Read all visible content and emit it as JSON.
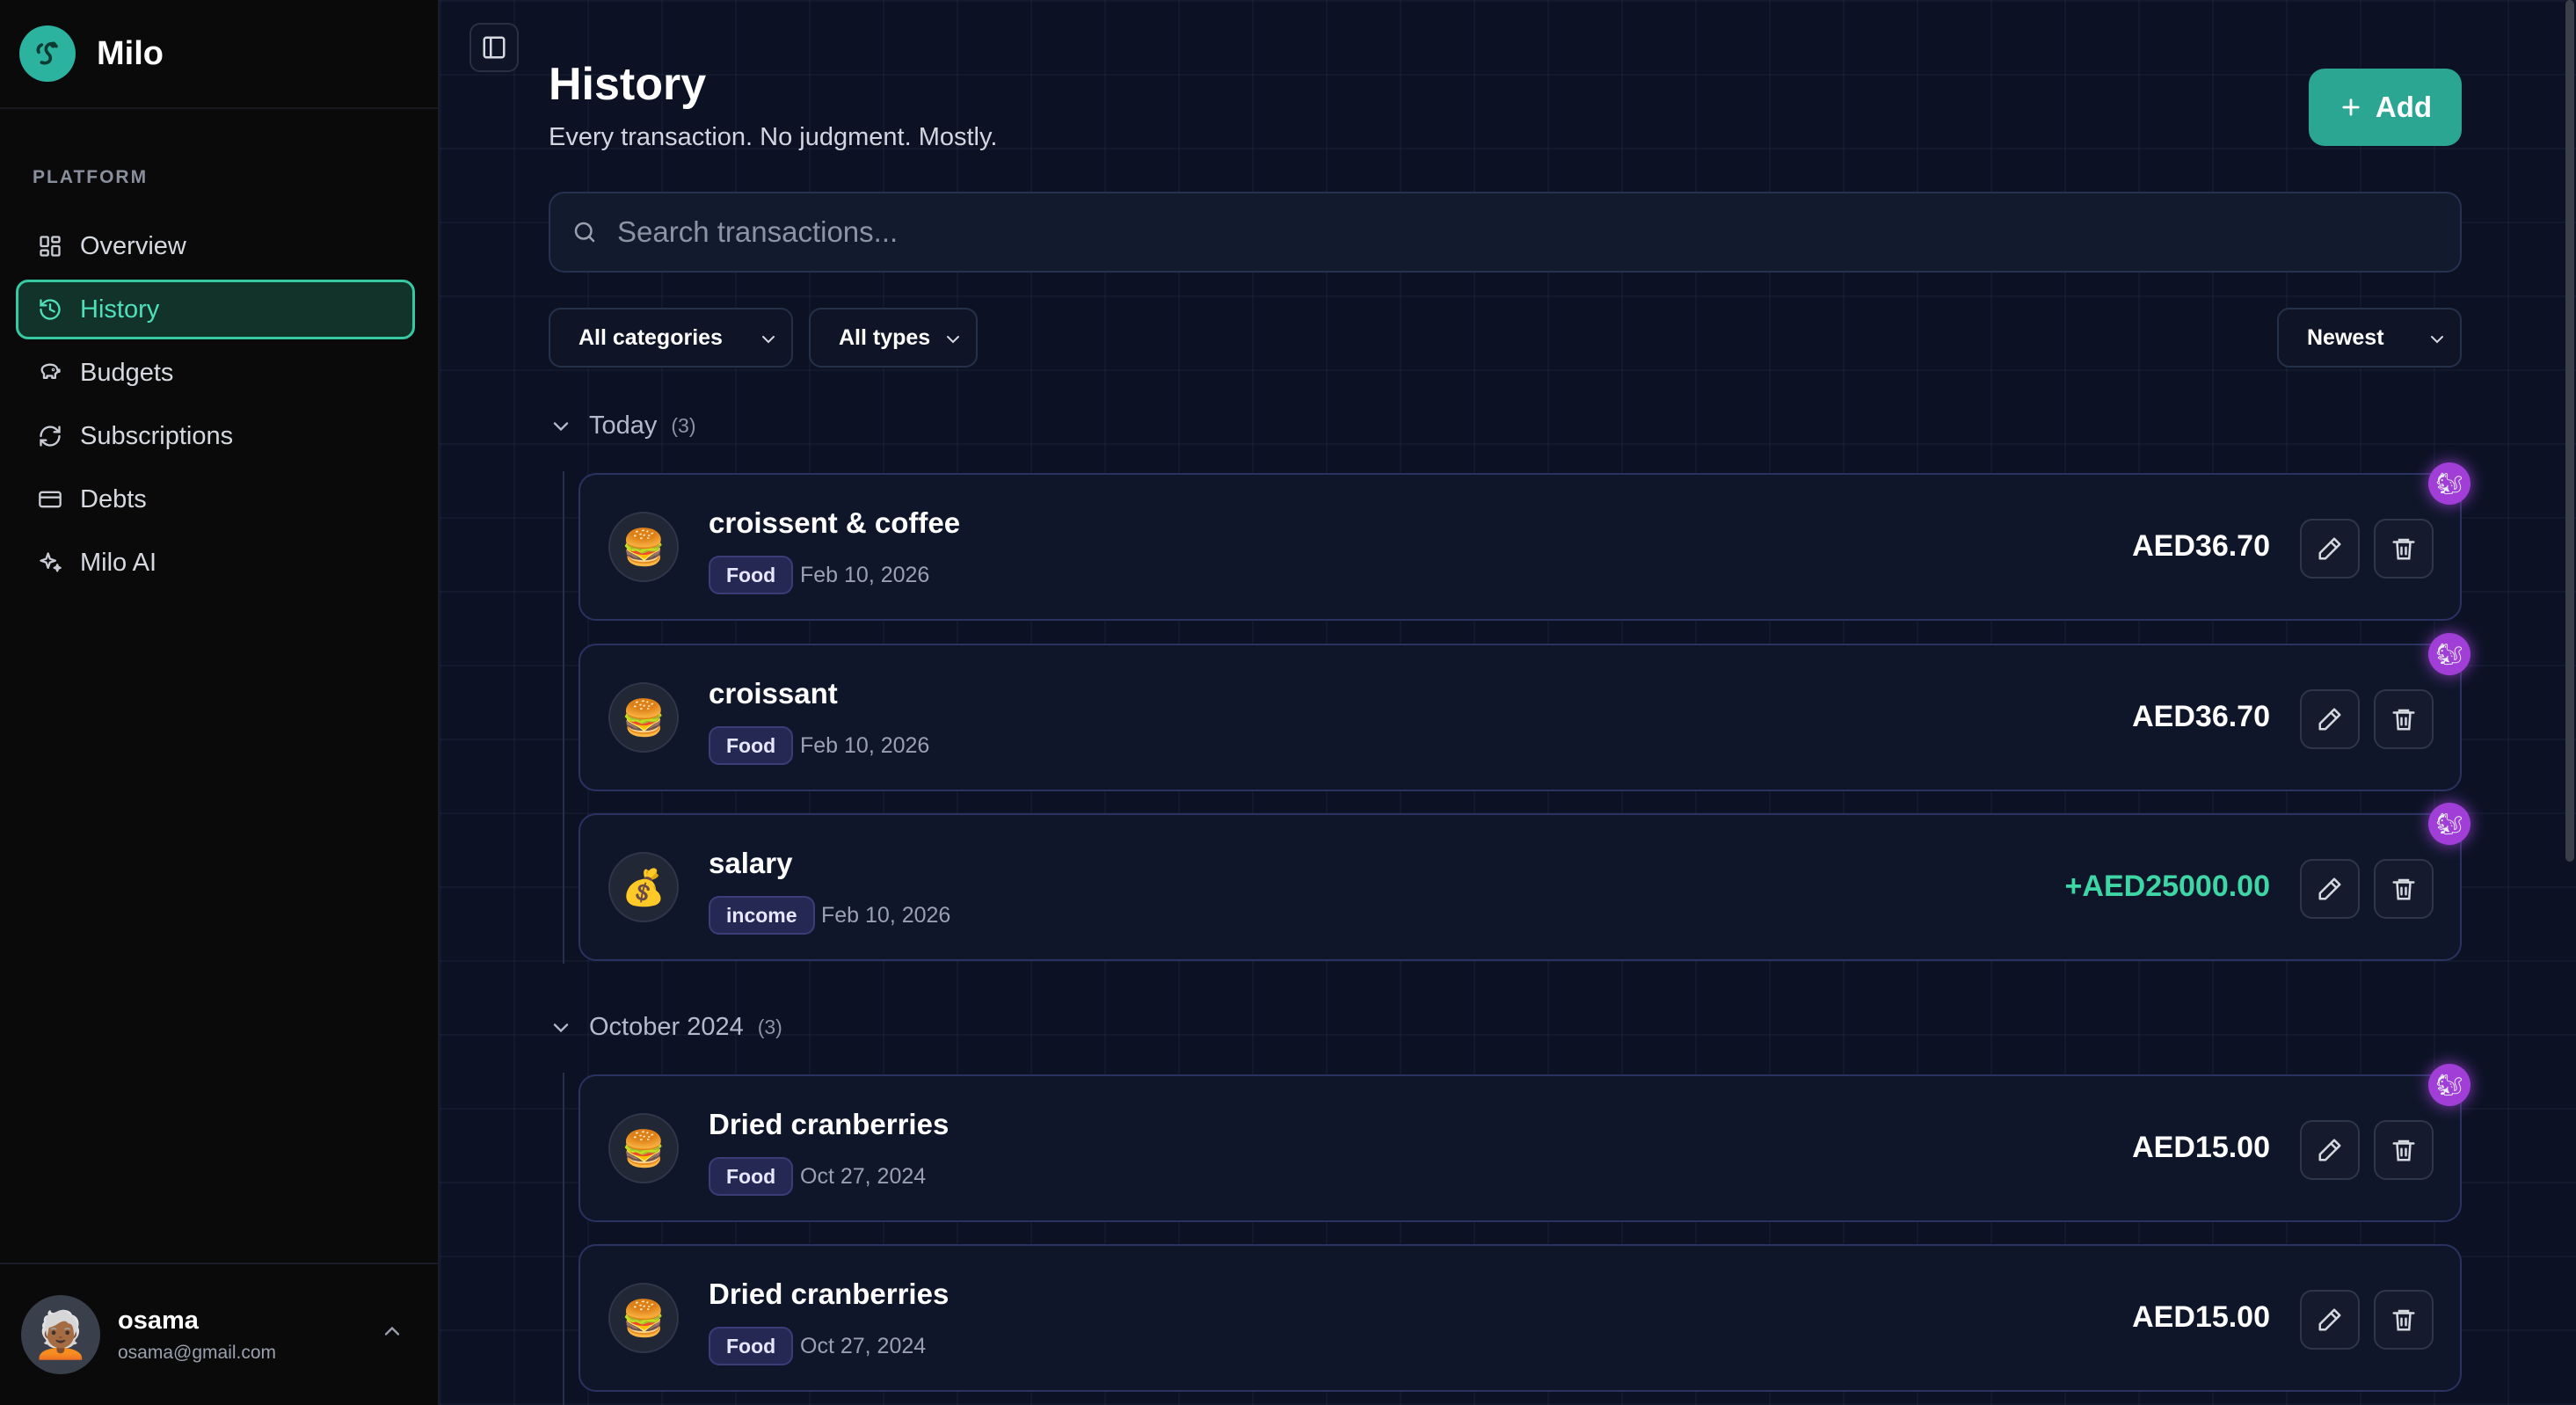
{
  "app": {
    "name": "Milo"
  },
  "sidebar": {
    "section_label": "PLATFORM",
    "items": [
      {
        "label": "Overview",
        "icon": "dashboard-icon"
      },
      {
        "label": "History",
        "icon": "history-icon",
        "active": true
      },
      {
        "label": "Budgets",
        "icon": "piggy-bank-icon"
      },
      {
        "label": "Subscriptions",
        "icon": "refresh-icon"
      },
      {
        "label": "Debts",
        "icon": "credit-card-icon"
      },
      {
        "label": "Milo AI",
        "icon": "sparkles-icon"
      }
    ],
    "user": {
      "name": "osama",
      "email": "osama@gmail.com"
    }
  },
  "header": {
    "title": "History",
    "subtitle": "Every transaction. No judgment. Mostly.",
    "add_label": "Add"
  },
  "search": {
    "placeholder": "Search transactions..."
  },
  "filters": {
    "category": "All categories",
    "type": "All types",
    "sort": "Newest"
  },
  "groups": [
    {
      "label": "Today",
      "count": "(3)",
      "transactions": [
        {
          "title": "croissent & coffee",
          "category": "Food",
          "date": "Feb 10, 2026",
          "amount": "AED36.70",
          "icon": "🍔"
        },
        {
          "title": "croissant",
          "category": "Food",
          "date": "Feb 10, 2026",
          "amount": "AED36.70",
          "icon": "🍔"
        },
        {
          "title": "salary",
          "category": "income",
          "date": "Feb 10, 2026",
          "amount": "+AED25000.00",
          "icon": "💰"
        }
      ]
    },
    {
      "label": "October 2024",
      "count": "(3)",
      "transactions": [
        {
          "title": "Dried cranberries",
          "category": "Food",
          "date": "Oct 27, 2024",
          "amount": "AED15.00",
          "icon": "🍔"
        },
        {
          "title": "Dried cranberries",
          "category": "Food",
          "date": "Oct 27, 2024",
          "amount": "AED15.00",
          "icon": "🍔"
        }
      ]
    }
  ],
  "colors": {
    "accent": "#2aa692",
    "income": "#3fd6a6",
    "milo_badge": "#a23ed8"
  }
}
